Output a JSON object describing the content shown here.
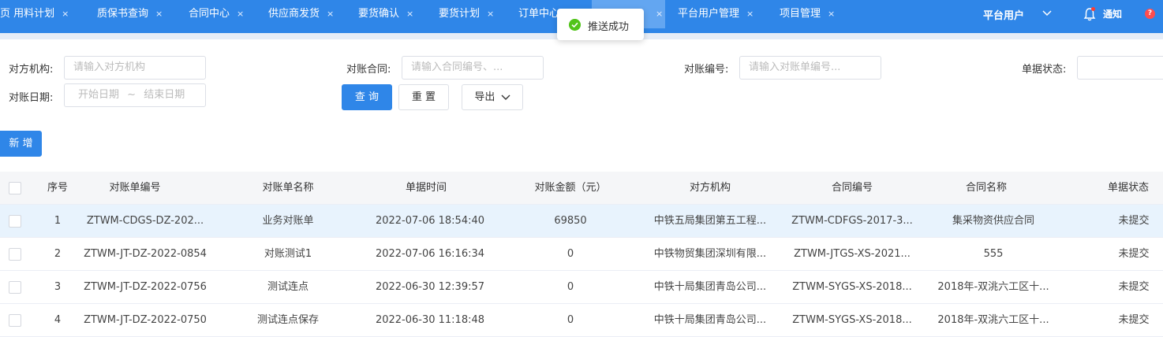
{
  "tabs": [
    {
      "label": "页  用料计划"
    },
    {
      "label": "质保书查询"
    },
    {
      "label": "合同中心"
    },
    {
      "label": "供应商发货"
    },
    {
      "label": "要货确认"
    },
    {
      "label": "要货计划"
    },
    {
      "label": "订单中心"
    },
    {
      "label": ""
    },
    {
      "label": "平台用户管理"
    },
    {
      "label": "项目管理"
    }
  ],
  "tab_close": "×",
  "header": {
    "user_label": "平台用户",
    "notice_label": "通知",
    "help_label": "?"
  },
  "toast": {
    "text": "推送成功"
  },
  "filters": {
    "counterparty_label": "对方机构:",
    "counterparty_placeholder": "请输入对方机构",
    "contract_label": "对账合同:",
    "contract_placeholder": "请输入合同编号、...",
    "statement_no_label": "对账编号:",
    "statement_no_placeholder": "请输入对账单编号...",
    "status_label": "单据状态:",
    "date_label": "对账日期:",
    "date_start": "开始日期",
    "date_sep": "~",
    "date_end": "结束日期"
  },
  "buttons": {
    "query": "查 询",
    "reset": "重 置",
    "export": "导出",
    "add": "新 增"
  },
  "table": {
    "headers": [
      "序号",
      "对账单编号",
      "对账单名称",
      "单据时间",
      "对账金额（元）",
      "对方机构",
      "合同编号",
      "合同名称",
      "单据状态"
    ],
    "rows": [
      [
        "1",
        "ZTWM-CDGS-DZ-202...",
        "业务对账单",
        "2022-07-06 18:54:40",
        "69850",
        "中铁五局集团第五工程...",
        "ZTWM-CDFGS-2017-3...",
        "集采物资供应合同",
        "未提交"
      ],
      [
        "2",
        "ZTWM-JT-DZ-2022-0854",
        "对账测试1",
        "2022-07-06 16:16:34",
        "0",
        "中铁物贸集团深圳有限...",
        "ZTWM-JTGS-XS-2021...",
        "555",
        "未提交"
      ],
      [
        "3",
        "ZTWM-JT-DZ-2022-0756",
        "测试连点",
        "2022-06-30 12:39:57",
        "0",
        "中铁十局集团青岛公司...",
        "ZTWM-SYGS-XS-2018...",
        "2018年-双洮六工区十...",
        "未提交"
      ],
      [
        "4",
        "ZTWM-JT-DZ-2022-0750",
        "测试连点保存",
        "2022-06-30 11:18:48",
        "0",
        "中铁十局集团青岛公司...",
        "ZTWM-SYGS-XS-2018...",
        "2018年-双洮六工区十...",
        "未提交"
      ]
    ]
  },
  "colors": {
    "primary": "#2f86e8",
    "success": "#52c41a",
    "row_highlight": "#e8f3fd"
  }
}
